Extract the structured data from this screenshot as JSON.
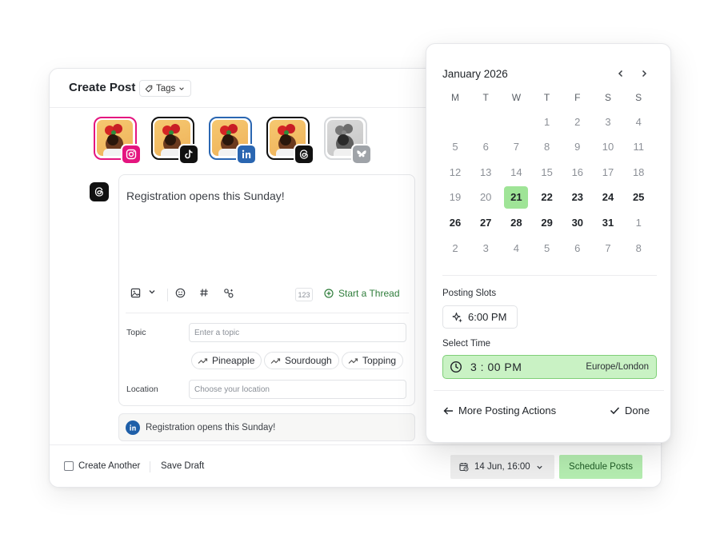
{
  "post": {
    "title": "Create Post",
    "tags_label": "Tags",
    "accounts": [
      {
        "network": "instagram",
        "badge_color": "#e4157f",
        "selected": true
      },
      {
        "network": "tiktok",
        "badge_color": "#111111",
        "selected": true
      },
      {
        "network": "linkedin",
        "badge_color": "#2a66b1",
        "selected": true
      },
      {
        "network": "threads",
        "badge_color": "#111111",
        "selected": true
      },
      {
        "network": "bluesky",
        "badge_color": "#9fa3a8",
        "selected": false
      }
    ],
    "editor": {
      "text": "Registration opens this Sunday!",
      "char_counter": "123",
      "start_thread_label": "Start a Thread"
    },
    "topic": {
      "label": "Topic",
      "placeholder": "Enter a topic",
      "suggestions": [
        "Pineapple",
        "Sourdough",
        "Topping"
      ]
    },
    "location": {
      "label": "Location",
      "placeholder": "Choose your location"
    },
    "preview_text": "Registration opens this Sunday!",
    "footer": {
      "create_another_label": "Create Another",
      "save_draft_label": "Save Draft",
      "date_label": "14 Jun, 16:00",
      "schedule_label": "Schedule Posts"
    }
  },
  "calendar": {
    "month_label": "January 2026",
    "weekdays": [
      "M",
      "T",
      "W",
      "T",
      "F",
      "S",
      "S"
    ],
    "weeks": [
      [
        {
          "d": "",
          "s": "muted"
        },
        {
          "d": "",
          "s": "muted"
        },
        {
          "d": "",
          "s": "muted"
        },
        {
          "d": "1",
          "s": "muted"
        },
        {
          "d": "2",
          "s": "muted"
        },
        {
          "d": "3",
          "s": "muted"
        },
        {
          "d": "4",
          "s": "muted"
        }
      ],
      [
        {
          "d": "5",
          "s": "muted"
        },
        {
          "d": "6",
          "s": "muted"
        },
        {
          "d": "7",
          "s": "muted"
        },
        {
          "d": "8",
          "s": "muted"
        },
        {
          "d": "9",
          "s": "muted"
        },
        {
          "d": "10",
          "s": "muted"
        },
        {
          "d": "11",
          "s": "muted"
        }
      ],
      [
        {
          "d": "12",
          "s": "muted"
        },
        {
          "d": "13",
          "s": "muted"
        },
        {
          "d": "14",
          "s": "muted"
        },
        {
          "d": "15",
          "s": "muted"
        },
        {
          "d": "16",
          "s": "muted"
        },
        {
          "d": "17",
          "s": "muted"
        },
        {
          "d": "18",
          "s": "muted"
        }
      ],
      [
        {
          "d": "19",
          "s": "muted"
        },
        {
          "d": "20",
          "s": "muted"
        },
        {
          "d": "21",
          "s": "selected"
        },
        {
          "d": "22",
          "s": "bold"
        },
        {
          "d": "23",
          "s": "bold"
        },
        {
          "d": "24",
          "s": "bold"
        },
        {
          "d": "25",
          "s": "bold"
        }
      ],
      [
        {
          "d": "26",
          "s": "bold"
        },
        {
          "d": "27",
          "s": "bold"
        },
        {
          "d": "28",
          "s": "bold"
        },
        {
          "d": "29",
          "s": "bold"
        },
        {
          "d": "30",
          "s": "bold"
        },
        {
          "d": "31",
          "s": "bold"
        },
        {
          "d": "1",
          "s": "muted"
        }
      ],
      [
        {
          "d": "2",
          "s": "muted"
        },
        {
          "d": "3",
          "s": "muted"
        },
        {
          "d": "4",
          "s": "muted"
        },
        {
          "d": "5",
          "s": "muted"
        },
        {
          "d": "6",
          "s": "muted"
        },
        {
          "d": "7",
          "s": "muted"
        },
        {
          "d": "8",
          "s": "muted"
        }
      ]
    ],
    "posting_slots_label": "Posting Slots",
    "slot_time": "6:00 PM",
    "select_time_label": "Select Time",
    "time_value": "3 : 00  PM",
    "timezone": "Europe/London",
    "more_actions_label": "More Posting Actions",
    "done_label": "Done"
  },
  "colors": {
    "accent_green": "#9fe497",
    "schedule_green": "#b4ecb0",
    "instagram": "#e4157f",
    "linkedin": "#2a66b1"
  }
}
